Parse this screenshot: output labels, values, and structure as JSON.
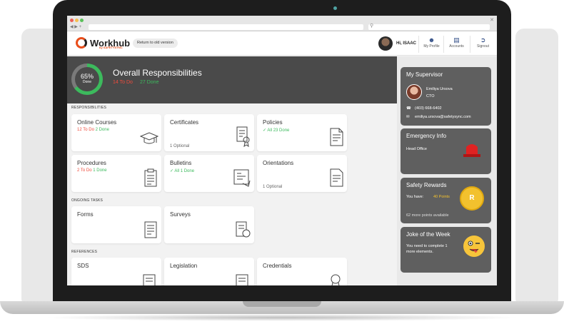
{
  "browser": {
    "nav": "◀ ▶ +"
  },
  "header": {
    "logo_text": "Workhub",
    "logo_sub": "by SAFETYSYNC",
    "old_version_label": "Return to old version",
    "greeting": "Hi, ISAAC",
    "my_profile": "My Profile",
    "accounts": "Accounts",
    "signout": "Signout"
  },
  "hero": {
    "percent": "65%",
    "percent_label": "Done",
    "title": "Overall Responsibilities",
    "todo": "14 To Do",
    "done": "27 Done"
  },
  "sections": {
    "responsibilities": "RESPONSIBILITIES",
    "ongoing": "ONGOING TASKS",
    "references": "REFERENCES"
  },
  "cards": {
    "online_courses": {
      "title": "Online Courses",
      "todo": "12 To Do",
      "done": "2 Done"
    },
    "certificates": {
      "title": "Certificates",
      "optional": "1 Optional"
    },
    "policies": {
      "title": "Policies",
      "status": "✓ All 23 Done"
    },
    "procedures": {
      "title": "Procedures",
      "todo": "2 To Do",
      "done": "1 Done"
    },
    "bulletins": {
      "title": "Bulletins",
      "status": "✓ All 1 Done"
    },
    "orientations": {
      "title": "Orientations",
      "optional": "1 Optional"
    },
    "forms": {
      "title": "Forms"
    },
    "surveys": {
      "title": "Surveys"
    },
    "sds": {
      "title": "SDS"
    },
    "legislation": {
      "title": "Legislation"
    },
    "credentials": {
      "title": "Credentials"
    }
  },
  "supervisor": {
    "title": "My Supervisor",
    "name": "Emiliya Ursova",
    "role": "CTO",
    "phone": "(403) 668-6402",
    "email": "emiliya.ursova@safetysync.com"
  },
  "emergency": {
    "title": "Emergency Info",
    "line": "Head Office"
  },
  "rewards": {
    "title": "Safety Rewards",
    "you_have": "You have:",
    "points": "40 Points",
    "more": "62 more points available",
    "coin": "R"
  },
  "joke": {
    "title": "Joke of the Week",
    "text1": "You need to complete 1",
    "text2": "more elements."
  },
  "colors": {
    "todo": "#ef4b3c",
    "done": "#3cba5d",
    "brand": "#e94e1b",
    "panel": "#5f5f5f"
  }
}
